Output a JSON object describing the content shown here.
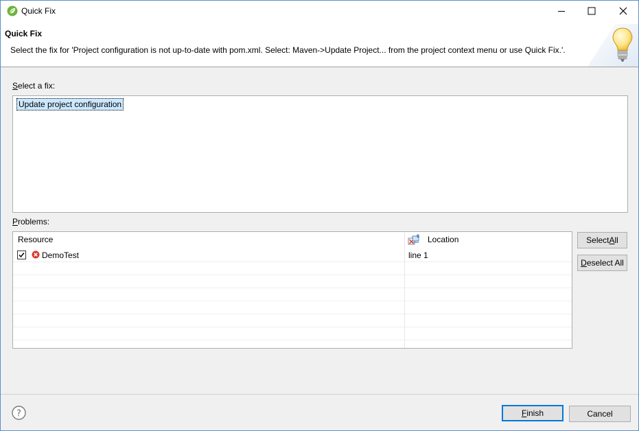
{
  "window": {
    "title": "Quick Fix",
    "controls": {
      "minimize": "minimize",
      "maximize": "maximize",
      "close": "close"
    }
  },
  "banner": {
    "title": "Quick Fix",
    "message": "Select the fix for 'Project configuration is not up-to-date with pom.xml. Select: Maven->Update Project... from the project context menu or use Quick Fix.'."
  },
  "fix_section": {
    "label_mnemonic": "S",
    "label_rest": "elect a fix:",
    "items": [
      "Update project configuration"
    ],
    "selected_index": 0
  },
  "problems_section": {
    "label_mnemonic": "P",
    "label_rest": "roblems:",
    "columns": [
      "Resource",
      "Location"
    ],
    "rows": [
      {
        "checked": true,
        "resource": "DemoTest",
        "location": "line 1",
        "severity": "error"
      }
    ]
  },
  "buttons": {
    "select_all_prefix": "Select ",
    "select_all_mnemonic": "A",
    "select_all_suffix": "ll",
    "deselect_all_mnemonic": "D",
    "deselect_all_suffix": "eselect All",
    "finish_mnemonic": "F",
    "finish_suffix": "inish",
    "cancel": "Cancel"
  },
  "colors": {
    "accent": "#0078d7",
    "selection": "#cce8ff",
    "error": "#d9342b",
    "window_border": "#5a8ec9"
  },
  "icons": {
    "app": "spring-leaf-icon",
    "banner": "lightbulb-icon",
    "error": "error-icon",
    "location_column": "location-icon",
    "help": "help-icon"
  }
}
